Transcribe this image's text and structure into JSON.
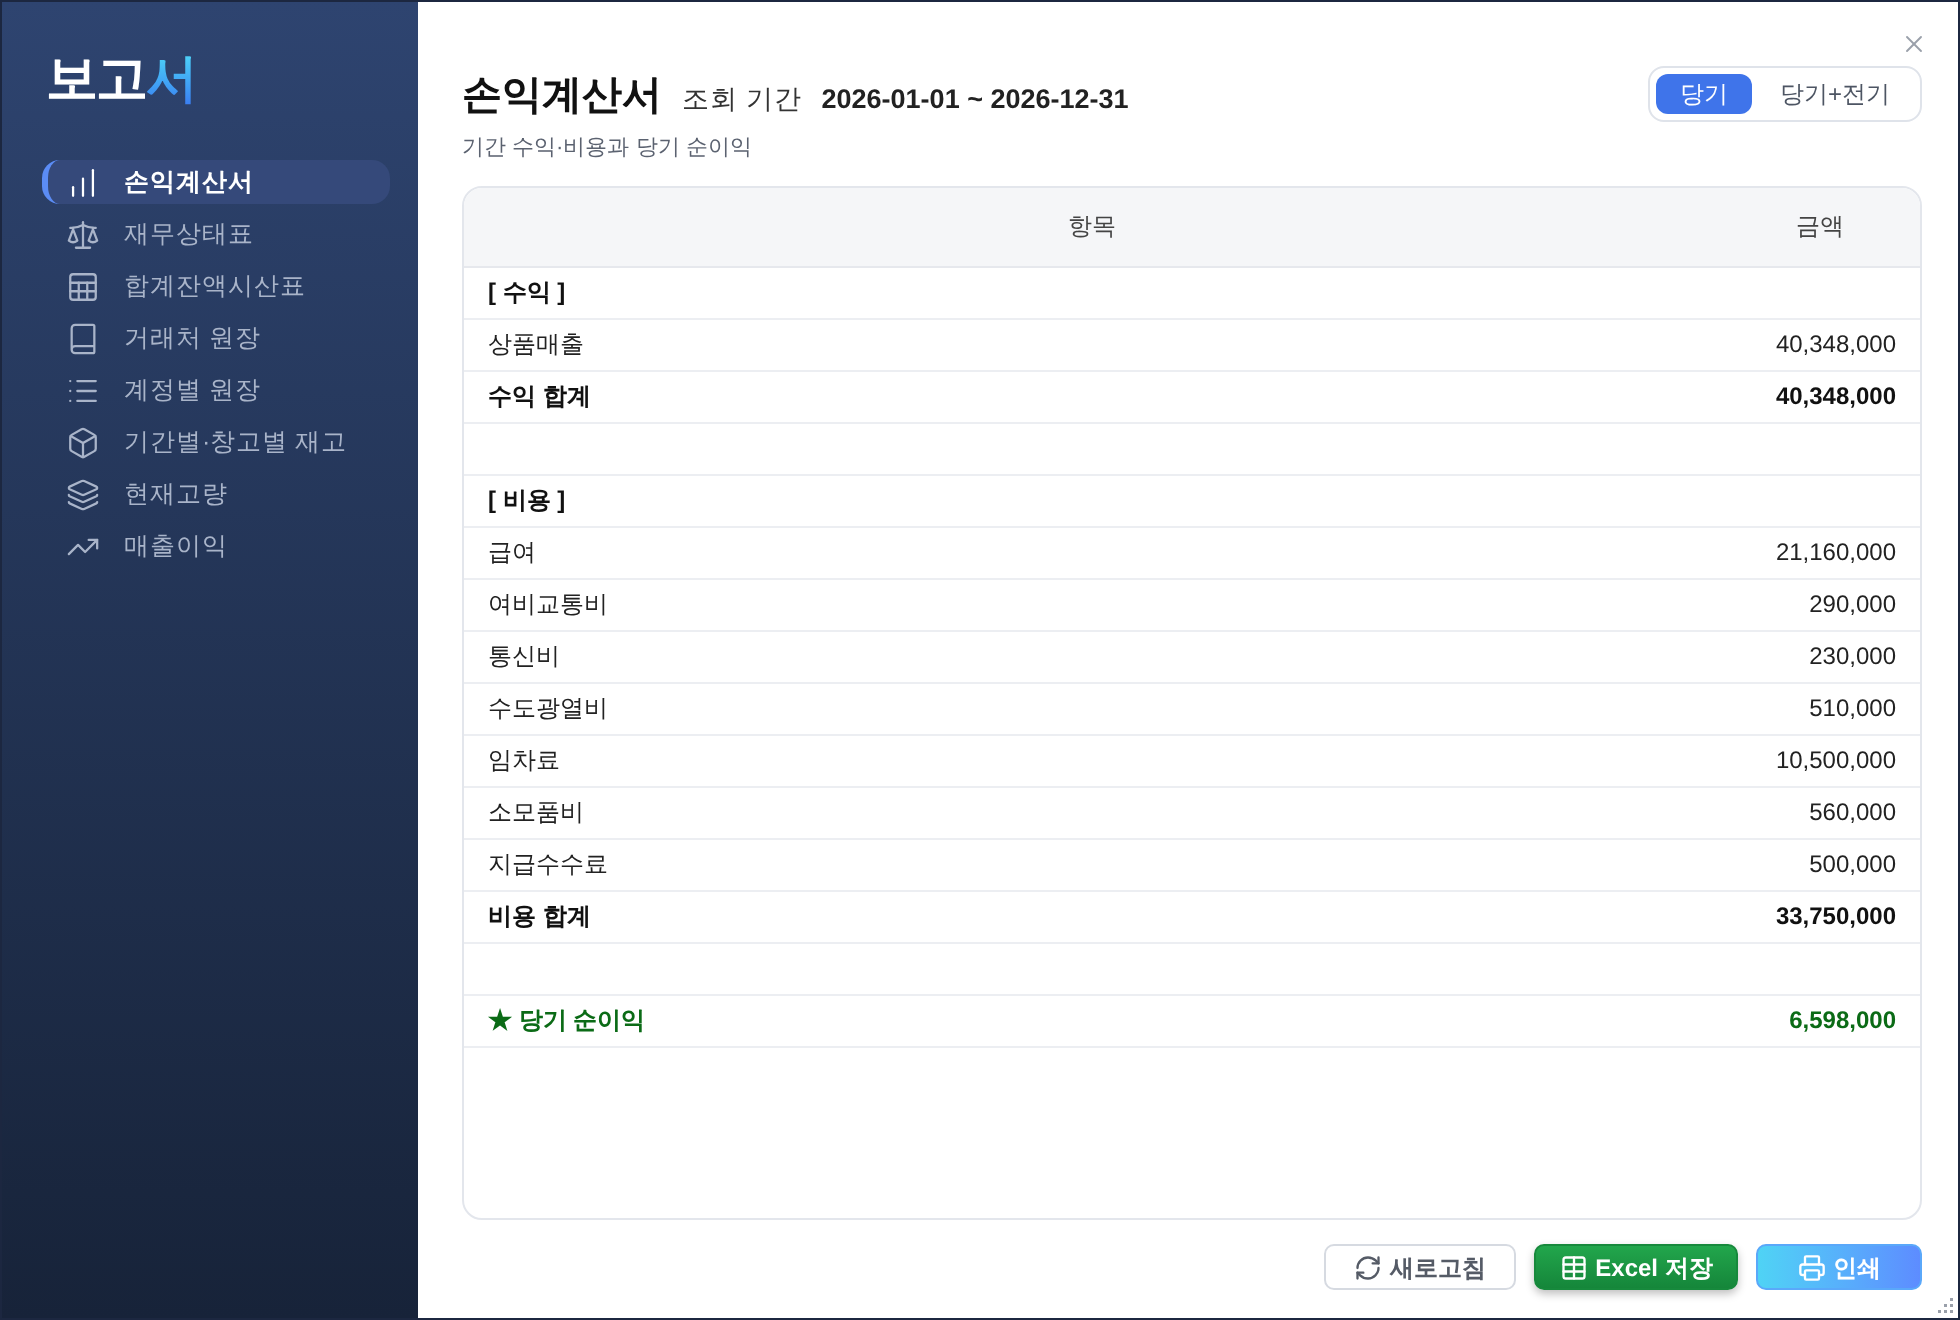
{
  "sidebar": {
    "logo": {
      "text": "보고",
      "accent": "서"
    },
    "items": [
      {
        "label": "손익계산서",
        "selected": true
      },
      {
        "label": "재무상태표",
        "selected": false
      },
      {
        "label": "합계잔액시산표",
        "selected": false
      },
      {
        "label": "거래처 원장",
        "selected": false
      },
      {
        "label": "계정별 원장",
        "selected": false
      },
      {
        "label": "기간별·창고별 재고",
        "selected": false
      },
      {
        "label": "현재고량",
        "selected": false
      },
      {
        "label": "매출이익",
        "selected": false
      }
    ]
  },
  "header": {
    "title": "손익계산서",
    "period_label": "조회 기간",
    "period": "2026-01-01 ~ 2026-12-31",
    "subtitle": "기간 수익·비용과 당기 순이익"
  },
  "view_toggle": [
    {
      "label": "당기",
      "selected": true
    },
    {
      "label": "당기+전기",
      "selected": false
    }
  ],
  "table": {
    "columns": [
      "항목",
      "금액"
    ],
    "rows": [
      {
        "kind": "section",
        "label": "[ 수익 ]"
      },
      {
        "kind": "item",
        "label": "상품매출",
        "amount": "40,348,000"
      },
      {
        "kind": "total",
        "label": "수익 합계",
        "amount": "40,348,000"
      },
      {
        "kind": "spacer"
      },
      {
        "kind": "section",
        "label": "[ 비용 ]"
      },
      {
        "kind": "item",
        "label": "급여",
        "amount": "21,160,000"
      },
      {
        "kind": "item",
        "label": "여비교통비",
        "amount": "290,000"
      },
      {
        "kind": "item",
        "label": "통신비",
        "amount": "230,000"
      },
      {
        "kind": "item",
        "label": "수도광열비",
        "amount": "510,000"
      },
      {
        "kind": "item",
        "label": "임차료",
        "amount": "10,500,000"
      },
      {
        "kind": "item",
        "label": "소모품비",
        "amount": "560,000"
      },
      {
        "kind": "item",
        "label": "지급수수료",
        "amount": "500,000"
      },
      {
        "kind": "total",
        "label": "비용 합계",
        "amount": "33,750,000"
      },
      {
        "kind": "spacer"
      },
      {
        "kind": "net",
        "label": "★ 당기 순이익",
        "amount": "6,598,000"
      }
    ]
  },
  "buttons": [
    {
      "label": "새로고침",
      "kind": "outline"
    },
    {
      "label": "Excel 저장",
      "kind": "success"
    },
    {
      "label": "인쇄",
      "kind": "primary"
    }
  ]
}
